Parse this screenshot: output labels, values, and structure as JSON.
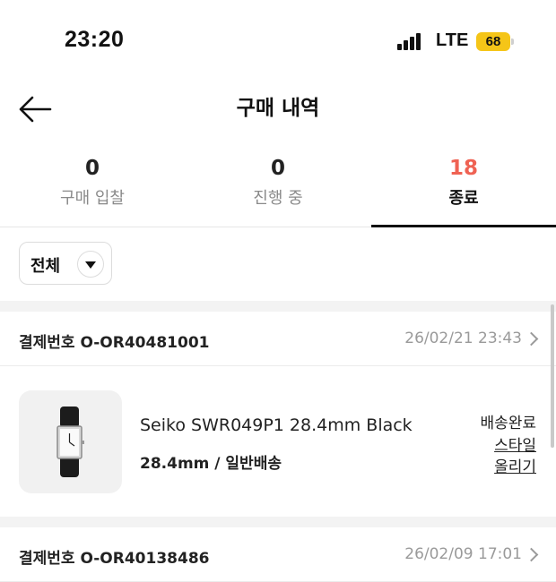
{
  "status_bar": {
    "time": "23:20",
    "network": "LTE",
    "battery": "68"
  },
  "header": {
    "title": "구매 내역"
  },
  "tabs": [
    {
      "count": "0",
      "label": "구매 입찰"
    },
    {
      "count": "0",
      "label": "진행 중"
    },
    {
      "count": "18",
      "label": "종료"
    }
  ],
  "filter": {
    "label": "전체"
  },
  "orders": [
    {
      "order_number": "결제번호 O-OR40481001",
      "date": "26/02/21 23:43",
      "product_name": "Seiko SWR049P1 28.4mm Black",
      "option": "28.4mm / 일반배송",
      "status": "배송완료",
      "style_link_line1": "스타일",
      "style_link_line2": "올리기"
    },
    {
      "order_number": "결제번호 O-OR40138486",
      "date": "26/02/09 17:01"
    }
  ],
  "colors": {
    "accent": "#ef6253",
    "battery": "#f5c518"
  }
}
